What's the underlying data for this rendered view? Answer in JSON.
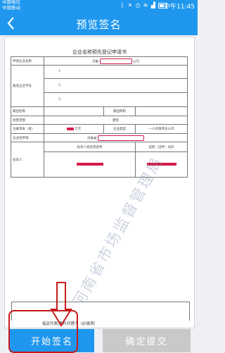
{
  "status_bar": {
    "carrier_1": "中国电信",
    "carrier_2": "中国移动",
    "time": "中午11:45"
  },
  "nav": {
    "title": "预览签名"
  },
  "document": {
    "title": "企业名称预先登记申请书",
    "rows": {
      "company_name_label": "申请企业名称",
      "company_name_prefix": "河南",
      "company_name_suffix": "公司",
      "alt_names_label": "备选企业字号",
      "alt_1": "1.",
      "alt_2": "2.",
      "alt_3": "3.",
      "new_name_label": "集团名称",
      "group_short_label": "集团简称",
      "business_scope_label": "经营范围",
      "business_scope_value": "建筑",
      "capital_label": "注册资本（金）",
      "capital_unit": "万元",
      "company_type_label": "企业类型",
      "company_type_value": "一人有限责任公司",
      "location_label": "企业住所地",
      "location_prefix": "河南省",
      "investor_label": "投资人",
      "investor_name_header": "投资人姓名或名称",
      "investor_id_header": "证照（证件）号码"
    },
    "watermark": "河南省市场监督管理局",
    "agent_line": "指定代表/委托代理人（必填项）"
  },
  "buttons": {
    "start_sign": "开始签名",
    "confirm_submit": "确定提交"
  },
  "colors": {
    "primary": "#1f97ee",
    "disabled": "#c9c9c9",
    "highlight_red": "#c71a1a"
  }
}
